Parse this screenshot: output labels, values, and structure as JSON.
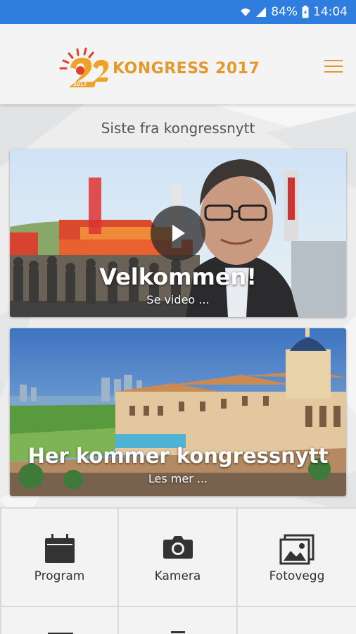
{
  "status_bar": {
    "battery": "84%",
    "time": "14:04",
    "icons": [
      "wifi-icon",
      "signal-icon",
      "battery-icon"
    ]
  },
  "header": {
    "title": "KONGRESS 2017",
    "logo_text": "2017",
    "menu_icon": "hamburger-icon",
    "accent_color": "#e39a2a"
  },
  "feed": {
    "section_title": "Siste fra kongressnytt",
    "cards": [
      {
        "heading": "Velkommen!",
        "subtext": "Se video ...",
        "media": "video"
      },
      {
        "heading": "Her kommer kongressnytt",
        "subtext": "Les mer ...",
        "media": "image"
      }
    ]
  },
  "menu": {
    "tiles": [
      {
        "label": "Program",
        "icon": "calendar-icon"
      },
      {
        "label": "Kamera",
        "icon": "camera-icon"
      },
      {
        "label": "Fotovegg",
        "icon": "photo-wall-icon"
      }
    ]
  },
  "colors": {
    "status_bar": "#2e7ddf",
    "header_bg": "#f4f4f5",
    "page_bg": "#ecedef"
  }
}
